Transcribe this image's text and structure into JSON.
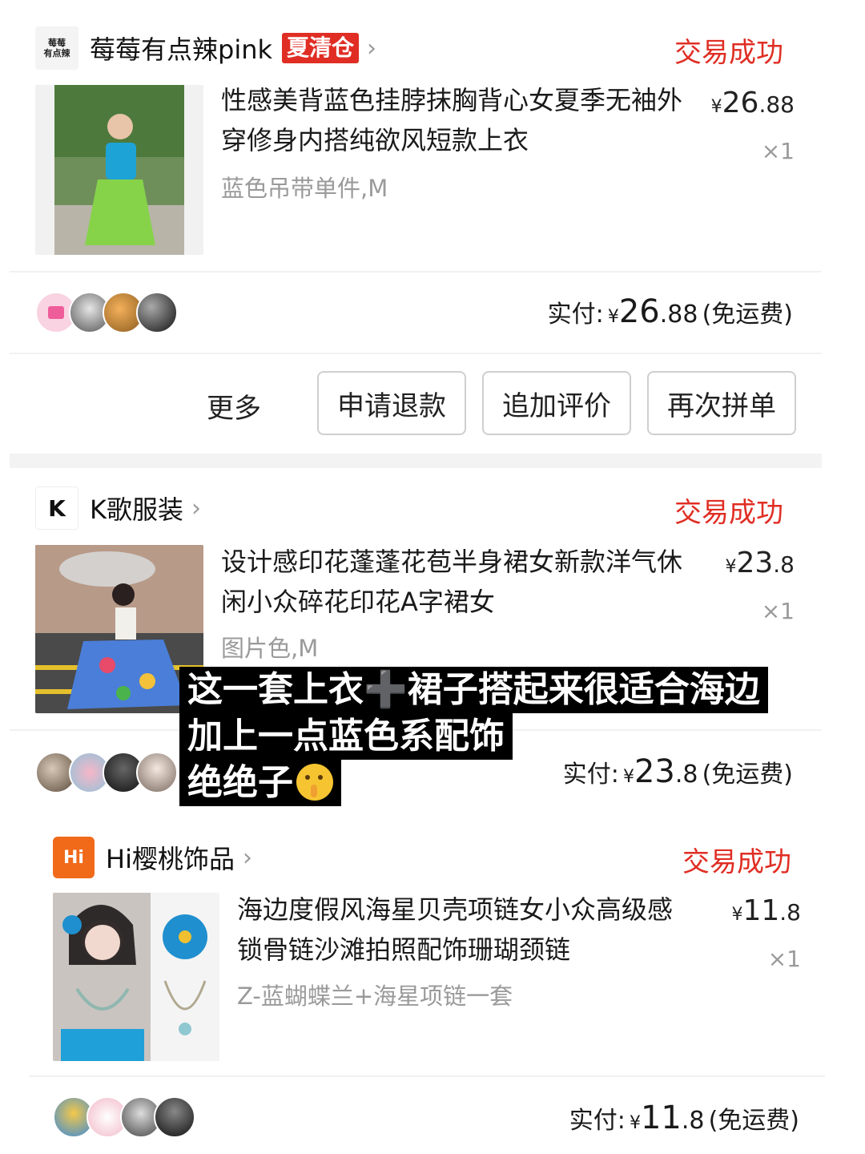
{
  "orders": [
    {
      "shop": {
        "logo_text": "莓莓\n有点辣",
        "name": "莓莓有点辣pink",
        "tag": "夏清仓",
        "chevron": "›"
      },
      "status": "交易成功",
      "product": {
        "title": "性感美背蓝色挂脖抹胸背心女夏季无袖外穿修身内搭纯欲风短款上衣",
        "sku": "蓝色吊带单件,M",
        "price_symbol": "¥",
        "price_int": "26",
        "price_dec": ".88",
        "qty": "×1"
      },
      "paid": {
        "label": "实付:",
        "symbol": "¥",
        "int": "26",
        "dec": ".88",
        "shipping": "(免运费)"
      },
      "actions": {
        "more": "更多",
        "refund": "申请退款",
        "review": "追加评价",
        "rebuy": "再次拼单"
      }
    },
    {
      "shop": {
        "logo_text": "K",
        "name": "K歌服装",
        "chevron": "›"
      },
      "status": "交易成功",
      "product": {
        "title": "设计感印花蓬蓬花苞半身裙女新款洋气休闲小众碎花印花A字裙女",
        "sku": "图片色,M",
        "price_symbol": "¥",
        "price_int": "23",
        "price_dec": ".8",
        "qty": "×1"
      },
      "paid": {
        "label": "实付:",
        "symbol": "¥",
        "int": "23",
        "dec": ".8",
        "shipping": "(免运费)"
      }
    },
    {
      "shop": {
        "logo_text": "Hi",
        "name": "Hi樱桃饰品",
        "chevron": "›"
      },
      "status": "交易成功",
      "product": {
        "title": "海边度假风海星贝壳项链女小众高级感锁骨链沙滩拍照配饰珊瑚颈链",
        "sku": "Z-蓝蝴蝶兰+海星项链一套",
        "price_symbol": "¥",
        "price_int": "11",
        "price_dec": ".8",
        "qty": "×1"
      },
      "paid": {
        "label": "实付:",
        "symbol": "¥",
        "int": "11",
        "dec": ".8",
        "shipping": "(免运费)"
      }
    }
  ],
  "caption": {
    "line1": "这一套上衣➕裙子搭起来很适合海边",
    "line2": "加上一点蓝色系配饰",
    "line3": "绝绝子"
  },
  "colors": {
    "accent": "#e02e24",
    "muted": "#9a9a9a"
  }
}
